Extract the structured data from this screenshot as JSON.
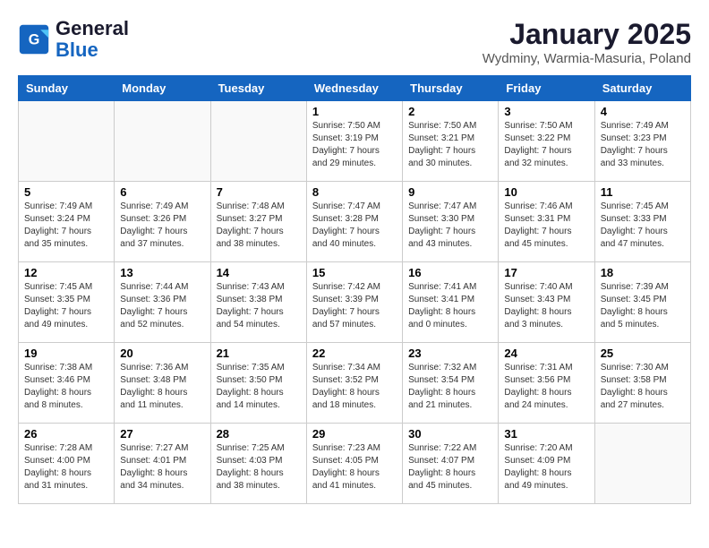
{
  "header": {
    "logo_line1": "General",
    "logo_line2": "Blue",
    "month": "January 2025",
    "location": "Wydminy, Warmia-Masuria, Poland"
  },
  "days_of_week": [
    "Sunday",
    "Monday",
    "Tuesday",
    "Wednesday",
    "Thursday",
    "Friday",
    "Saturday"
  ],
  "weeks": [
    [
      {
        "day": "",
        "info": ""
      },
      {
        "day": "",
        "info": ""
      },
      {
        "day": "",
        "info": ""
      },
      {
        "day": "1",
        "info": "Sunrise: 7:50 AM\nSunset: 3:19 PM\nDaylight: 7 hours\nand 29 minutes."
      },
      {
        "day": "2",
        "info": "Sunrise: 7:50 AM\nSunset: 3:21 PM\nDaylight: 7 hours\nand 30 minutes."
      },
      {
        "day": "3",
        "info": "Sunrise: 7:50 AM\nSunset: 3:22 PM\nDaylight: 7 hours\nand 32 minutes."
      },
      {
        "day": "4",
        "info": "Sunrise: 7:49 AM\nSunset: 3:23 PM\nDaylight: 7 hours\nand 33 minutes."
      }
    ],
    [
      {
        "day": "5",
        "info": "Sunrise: 7:49 AM\nSunset: 3:24 PM\nDaylight: 7 hours\nand 35 minutes."
      },
      {
        "day": "6",
        "info": "Sunrise: 7:49 AM\nSunset: 3:26 PM\nDaylight: 7 hours\nand 37 minutes."
      },
      {
        "day": "7",
        "info": "Sunrise: 7:48 AM\nSunset: 3:27 PM\nDaylight: 7 hours\nand 38 minutes."
      },
      {
        "day": "8",
        "info": "Sunrise: 7:47 AM\nSunset: 3:28 PM\nDaylight: 7 hours\nand 40 minutes."
      },
      {
        "day": "9",
        "info": "Sunrise: 7:47 AM\nSunset: 3:30 PM\nDaylight: 7 hours\nand 43 minutes."
      },
      {
        "day": "10",
        "info": "Sunrise: 7:46 AM\nSunset: 3:31 PM\nDaylight: 7 hours\nand 45 minutes."
      },
      {
        "day": "11",
        "info": "Sunrise: 7:45 AM\nSunset: 3:33 PM\nDaylight: 7 hours\nand 47 minutes."
      }
    ],
    [
      {
        "day": "12",
        "info": "Sunrise: 7:45 AM\nSunset: 3:35 PM\nDaylight: 7 hours\nand 49 minutes."
      },
      {
        "day": "13",
        "info": "Sunrise: 7:44 AM\nSunset: 3:36 PM\nDaylight: 7 hours\nand 52 minutes."
      },
      {
        "day": "14",
        "info": "Sunrise: 7:43 AM\nSunset: 3:38 PM\nDaylight: 7 hours\nand 54 minutes."
      },
      {
        "day": "15",
        "info": "Sunrise: 7:42 AM\nSunset: 3:39 PM\nDaylight: 7 hours\nand 57 minutes."
      },
      {
        "day": "16",
        "info": "Sunrise: 7:41 AM\nSunset: 3:41 PM\nDaylight: 8 hours\nand 0 minutes."
      },
      {
        "day": "17",
        "info": "Sunrise: 7:40 AM\nSunset: 3:43 PM\nDaylight: 8 hours\nand 3 minutes."
      },
      {
        "day": "18",
        "info": "Sunrise: 7:39 AM\nSunset: 3:45 PM\nDaylight: 8 hours\nand 5 minutes."
      }
    ],
    [
      {
        "day": "19",
        "info": "Sunrise: 7:38 AM\nSunset: 3:46 PM\nDaylight: 8 hours\nand 8 minutes."
      },
      {
        "day": "20",
        "info": "Sunrise: 7:36 AM\nSunset: 3:48 PM\nDaylight: 8 hours\nand 11 minutes."
      },
      {
        "day": "21",
        "info": "Sunrise: 7:35 AM\nSunset: 3:50 PM\nDaylight: 8 hours\nand 14 minutes."
      },
      {
        "day": "22",
        "info": "Sunrise: 7:34 AM\nSunset: 3:52 PM\nDaylight: 8 hours\nand 18 minutes."
      },
      {
        "day": "23",
        "info": "Sunrise: 7:32 AM\nSunset: 3:54 PM\nDaylight: 8 hours\nand 21 minutes."
      },
      {
        "day": "24",
        "info": "Sunrise: 7:31 AM\nSunset: 3:56 PM\nDaylight: 8 hours\nand 24 minutes."
      },
      {
        "day": "25",
        "info": "Sunrise: 7:30 AM\nSunset: 3:58 PM\nDaylight: 8 hours\nand 27 minutes."
      }
    ],
    [
      {
        "day": "26",
        "info": "Sunrise: 7:28 AM\nSunset: 4:00 PM\nDaylight: 8 hours\nand 31 minutes."
      },
      {
        "day": "27",
        "info": "Sunrise: 7:27 AM\nSunset: 4:01 PM\nDaylight: 8 hours\nand 34 minutes."
      },
      {
        "day": "28",
        "info": "Sunrise: 7:25 AM\nSunset: 4:03 PM\nDaylight: 8 hours\nand 38 minutes."
      },
      {
        "day": "29",
        "info": "Sunrise: 7:23 AM\nSunset: 4:05 PM\nDaylight: 8 hours\nand 41 minutes."
      },
      {
        "day": "30",
        "info": "Sunrise: 7:22 AM\nSunset: 4:07 PM\nDaylight: 8 hours\nand 45 minutes."
      },
      {
        "day": "31",
        "info": "Sunrise: 7:20 AM\nSunset: 4:09 PM\nDaylight: 8 hours\nand 49 minutes."
      },
      {
        "day": "",
        "info": ""
      }
    ]
  ]
}
